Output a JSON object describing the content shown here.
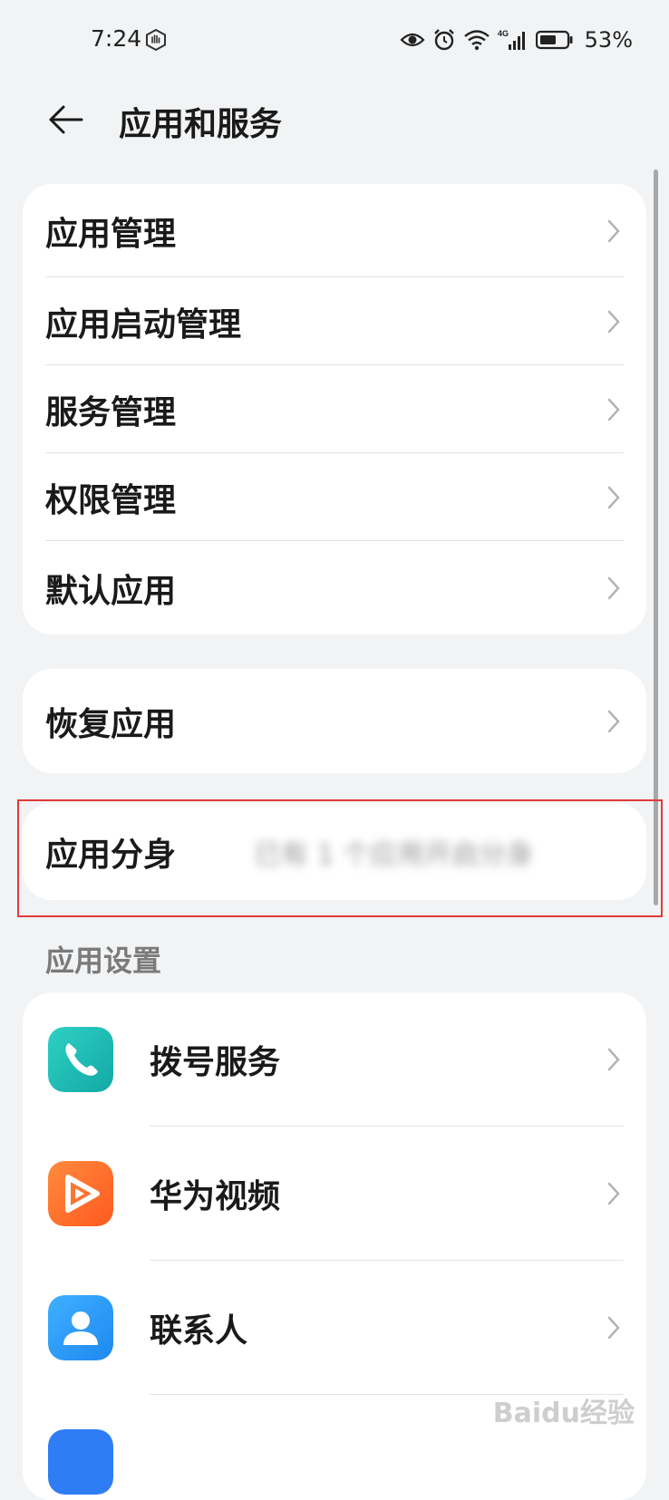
{
  "status_bar": {
    "time": "7:24",
    "battery": "53%",
    "network": "4G"
  },
  "header": {
    "title": "应用和服务"
  },
  "group1": {
    "items": [
      {
        "label": "应用管理"
      },
      {
        "label": "应用启动管理"
      },
      {
        "label": "服务管理"
      },
      {
        "label": "权限管理"
      },
      {
        "label": "默认应用"
      }
    ]
  },
  "group2": {
    "items": [
      {
        "label": "恢复应用"
      }
    ]
  },
  "group3": {
    "label": "应用分身",
    "value": "已有 1 个应用开启分身"
  },
  "app_settings": {
    "header": "应用设置",
    "items": [
      {
        "label": "拨号服务",
        "icon": "phone-icon",
        "color": "#1bb8b2"
      },
      {
        "label": "华为视频",
        "icon": "video-icon",
        "color": "#ff6a2b"
      },
      {
        "label": "联系人",
        "icon": "contacts-icon",
        "color": "#2f9bf5"
      }
    ]
  },
  "colors": {
    "background": "#f1f3f5",
    "card": "#ffffff",
    "highlight_border": "#e03b3b"
  },
  "watermark": "Baidu经验"
}
